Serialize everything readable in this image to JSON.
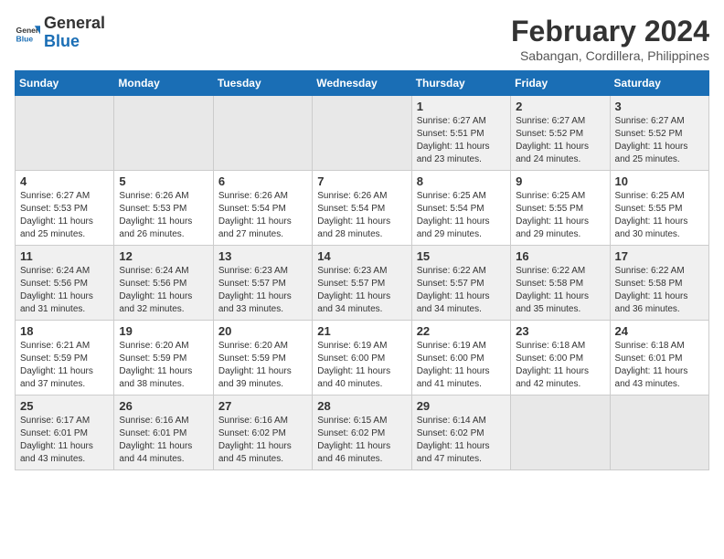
{
  "header": {
    "logo_general": "General",
    "logo_blue": "Blue",
    "month_year": "February 2024",
    "location": "Sabangan, Cordillera, Philippines"
  },
  "weekdays": [
    "Sunday",
    "Monday",
    "Tuesday",
    "Wednesday",
    "Thursday",
    "Friday",
    "Saturday"
  ],
  "weeks": [
    [
      {
        "day": "",
        "info": ""
      },
      {
        "day": "",
        "info": ""
      },
      {
        "day": "",
        "info": ""
      },
      {
        "day": "",
        "info": ""
      },
      {
        "day": "1",
        "info": "Sunrise: 6:27 AM\nSunset: 5:51 PM\nDaylight: 11 hours and 23 minutes."
      },
      {
        "day": "2",
        "info": "Sunrise: 6:27 AM\nSunset: 5:52 PM\nDaylight: 11 hours and 24 minutes."
      },
      {
        "day": "3",
        "info": "Sunrise: 6:27 AM\nSunset: 5:52 PM\nDaylight: 11 hours and 25 minutes."
      }
    ],
    [
      {
        "day": "4",
        "info": "Sunrise: 6:27 AM\nSunset: 5:53 PM\nDaylight: 11 hours and 25 minutes."
      },
      {
        "day": "5",
        "info": "Sunrise: 6:26 AM\nSunset: 5:53 PM\nDaylight: 11 hours and 26 minutes."
      },
      {
        "day": "6",
        "info": "Sunrise: 6:26 AM\nSunset: 5:54 PM\nDaylight: 11 hours and 27 minutes."
      },
      {
        "day": "7",
        "info": "Sunrise: 6:26 AM\nSunset: 5:54 PM\nDaylight: 11 hours and 28 minutes."
      },
      {
        "day": "8",
        "info": "Sunrise: 6:25 AM\nSunset: 5:54 PM\nDaylight: 11 hours and 29 minutes."
      },
      {
        "day": "9",
        "info": "Sunrise: 6:25 AM\nSunset: 5:55 PM\nDaylight: 11 hours and 29 minutes."
      },
      {
        "day": "10",
        "info": "Sunrise: 6:25 AM\nSunset: 5:55 PM\nDaylight: 11 hours and 30 minutes."
      }
    ],
    [
      {
        "day": "11",
        "info": "Sunrise: 6:24 AM\nSunset: 5:56 PM\nDaylight: 11 hours and 31 minutes."
      },
      {
        "day": "12",
        "info": "Sunrise: 6:24 AM\nSunset: 5:56 PM\nDaylight: 11 hours and 32 minutes."
      },
      {
        "day": "13",
        "info": "Sunrise: 6:23 AM\nSunset: 5:57 PM\nDaylight: 11 hours and 33 minutes."
      },
      {
        "day": "14",
        "info": "Sunrise: 6:23 AM\nSunset: 5:57 PM\nDaylight: 11 hours and 34 minutes."
      },
      {
        "day": "15",
        "info": "Sunrise: 6:22 AM\nSunset: 5:57 PM\nDaylight: 11 hours and 34 minutes."
      },
      {
        "day": "16",
        "info": "Sunrise: 6:22 AM\nSunset: 5:58 PM\nDaylight: 11 hours and 35 minutes."
      },
      {
        "day": "17",
        "info": "Sunrise: 6:22 AM\nSunset: 5:58 PM\nDaylight: 11 hours and 36 minutes."
      }
    ],
    [
      {
        "day": "18",
        "info": "Sunrise: 6:21 AM\nSunset: 5:59 PM\nDaylight: 11 hours and 37 minutes."
      },
      {
        "day": "19",
        "info": "Sunrise: 6:20 AM\nSunset: 5:59 PM\nDaylight: 11 hours and 38 minutes."
      },
      {
        "day": "20",
        "info": "Sunrise: 6:20 AM\nSunset: 5:59 PM\nDaylight: 11 hours and 39 minutes."
      },
      {
        "day": "21",
        "info": "Sunrise: 6:19 AM\nSunset: 6:00 PM\nDaylight: 11 hours and 40 minutes."
      },
      {
        "day": "22",
        "info": "Sunrise: 6:19 AM\nSunset: 6:00 PM\nDaylight: 11 hours and 41 minutes."
      },
      {
        "day": "23",
        "info": "Sunrise: 6:18 AM\nSunset: 6:00 PM\nDaylight: 11 hours and 42 minutes."
      },
      {
        "day": "24",
        "info": "Sunrise: 6:18 AM\nSunset: 6:01 PM\nDaylight: 11 hours and 43 minutes."
      }
    ],
    [
      {
        "day": "25",
        "info": "Sunrise: 6:17 AM\nSunset: 6:01 PM\nDaylight: 11 hours and 43 minutes."
      },
      {
        "day": "26",
        "info": "Sunrise: 6:16 AM\nSunset: 6:01 PM\nDaylight: 11 hours and 44 minutes."
      },
      {
        "day": "27",
        "info": "Sunrise: 6:16 AM\nSunset: 6:02 PM\nDaylight: 11 hours and 45 minutes."
      },
      {
        "day": "28",
        "info": "Sunrise: 6:15 AM\nSunset: 6:02 PM\nDaylight: 11 hours and 46 minutes."
      },
      {
        "day": "29",
        "info": "Sunrise: 6:14 AM\nSunset: 6:02 PM\nDaylight: 11 hours and 47 minutes."
      },
      {
        "day": "",
        "info": ""
      },
      {
        "day": "",
        "info": ""
      }
    ]
  ]
}
